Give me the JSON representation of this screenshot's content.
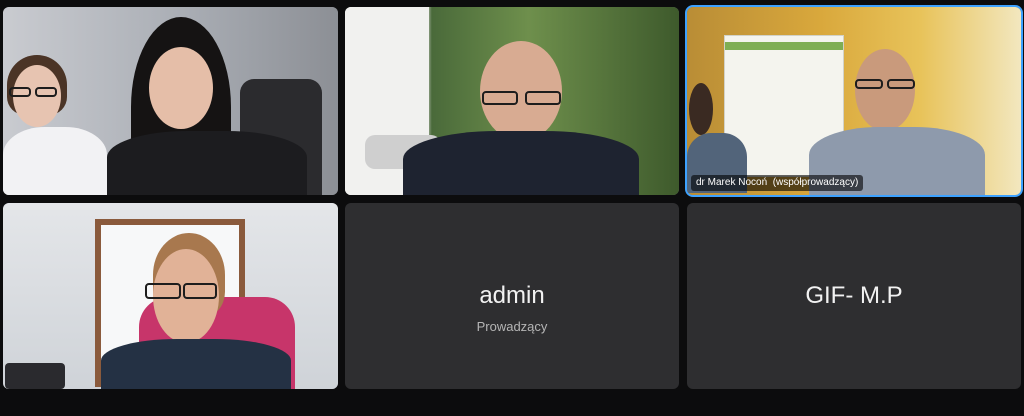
{
  "tiles": [
    {
      "id": "participant-1",
      "type": "video",
      "label": ""
    },
    {
      "id": "participant-2",
      "type": "video",
      "label": ""
    },
    {
      "id": "participant-3",
      "type": "video",
      "label": "dr Marek Nocoń  (współprowadzący)",
      "active": true
    },
    {
      "id": "participant-4",
      "type": "video",
      "label": ""
    },
    {
      "id": "participant-5",
      "type": "avatar",
      "name": "admin",
      "role": "Prowadzący"
    },
    {
      "id": "participant-6",
      "type": "avatar",
      "name": "GIF- M.P",
      "role": ""
    }
  ],
  "colors": {
    "background": "#0c0c0d",
    "tile_placeholder": "#2e2e30",
    "active_speaker_border": "#3ea2ff"
  }
}
